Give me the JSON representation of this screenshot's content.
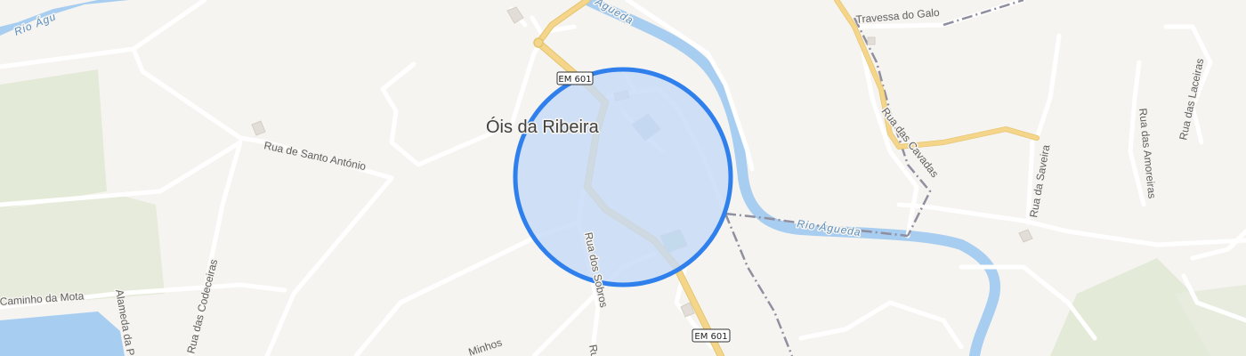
{
  "map": {
    "place_name": "Óis da Ribeira",
    "route_shields": [
      "EM 601",
      "EM 601"
    ],
    "streets": {
      "travessa_do_galo": "Travessa do Galo",
      "rua_das_cavadas": "Rua das Cavadas",
      "rua_da_saveira": "Rua da Saveira",
      "rua_das_amoreiras": "Rua das Amoreiras",
      "rua_das_laceiras": "Rua das Laceiras",
      "rua_de_santo_antonio": "Rua de Santo António",
      "rua_dos_sobros": "Rua dos Sobros",
      "caminho_da_mota": "Caminho da Mota",
      "alameda": "Alameda da P",
      "rua_das_codeceiras": "Rua das Codeceiras",
      "rua_bottom": "Ru",
      "minhos_partial": "Minhos"
    },
    "rivers": {
      "agueda_main": "Rio Águeda",
      "agueda_upper": "Águeda",
      "agueda_left": "Rio Águ"
    },
    "colors": {
      "background": "#f6f4f0",
      "water": "#a7cdf0",
      "primary_road": "#f5d58a",
      "railway": "#8f8fa0",
      "park": "#e4ead8",
      "location_fill": "#c6daf7",
      "location_stroke": "#2f80ed"
    }
  }
}
